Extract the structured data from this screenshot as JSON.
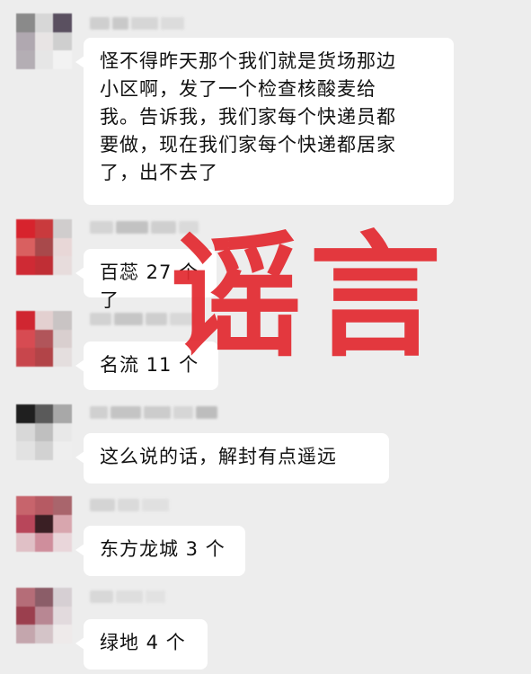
{
  "chat": {
    "messages": [
      {
        "text": "怪不得昨天那个我们就是货场那边\n小区啊，发了一个检查核酸麦给\n我。告诉我，我们家每个快递员都\n要做，现在我们家每个快递都居家\n了，出不去了",
        "avatar_colors": [
          "#8a8a8a",
          "#d7d7d7",
          "#5a5060",
          "#b0a8b0",
          "#e8e4e4",
          "#cfcfcf",
          "#b4aeb4",
          "#e6e6e6",
          "#f2f2f2"
        ]
      },
      {
        "text": "百蕊 27 个了",
        "avatar_colors": [
          "#d7232d",
          "#c93a3d",
          "#d0cdcd",
          "#d96060",
          "#a8494b",
          "#e8d7d7",
          "#cf2a34",
          "#c02e35",
          "#e7dcdc"
        ]
      },
      {
        "text": "名流 11 个",
        "avatar_colors": [
          "#d02631",
          "#e3d0d0",
          "#c9c4c4",
          "#d74b52",
          "#b1555a",
          "#d9cfcf",
          "#c8464c",
          "#b24448",
          "#e4dede"
        ]
      },
      {
        "text": "这么说的话，解封有点遥远",
        "avatar_colors": [
          "#1f1f1f",
          "#5a5a5a",
          "#a8a8a8",
          "#d8d8d8",
          "#bfbfbf",
          "#e8e8e8",
          "#e2e2e2",
          "#d2d2d2",
          "#eeeeee"
        ]
      },
      {
        "text": "东方龙城 3 个",
        "avatar_colors": [
          "#c7646c",
          "#b65a63",
          "#a9656c",
          "#b8465a",
          "#3a1f24",
          "#d8a6ae",
          "#e0c0c6",
          "#cf8e9c",
          "#e9d6da"
        ]
      },
      {
        "text": "绿地 4 个",
        "avatar_colors": [
          "#b56d78",
          "#8b5d68",
          "#d6cfd3",
          "#9b3f4e",
          "#b88793",
          "#e2dadd",
          "#c4a6ad",
          "#d4c4c8",
          "#eeeaea"
        ]
      }
    ]
  },
  "stamp": {
    "text": "谣言",
    "color": "#e32b31"
  }
}
